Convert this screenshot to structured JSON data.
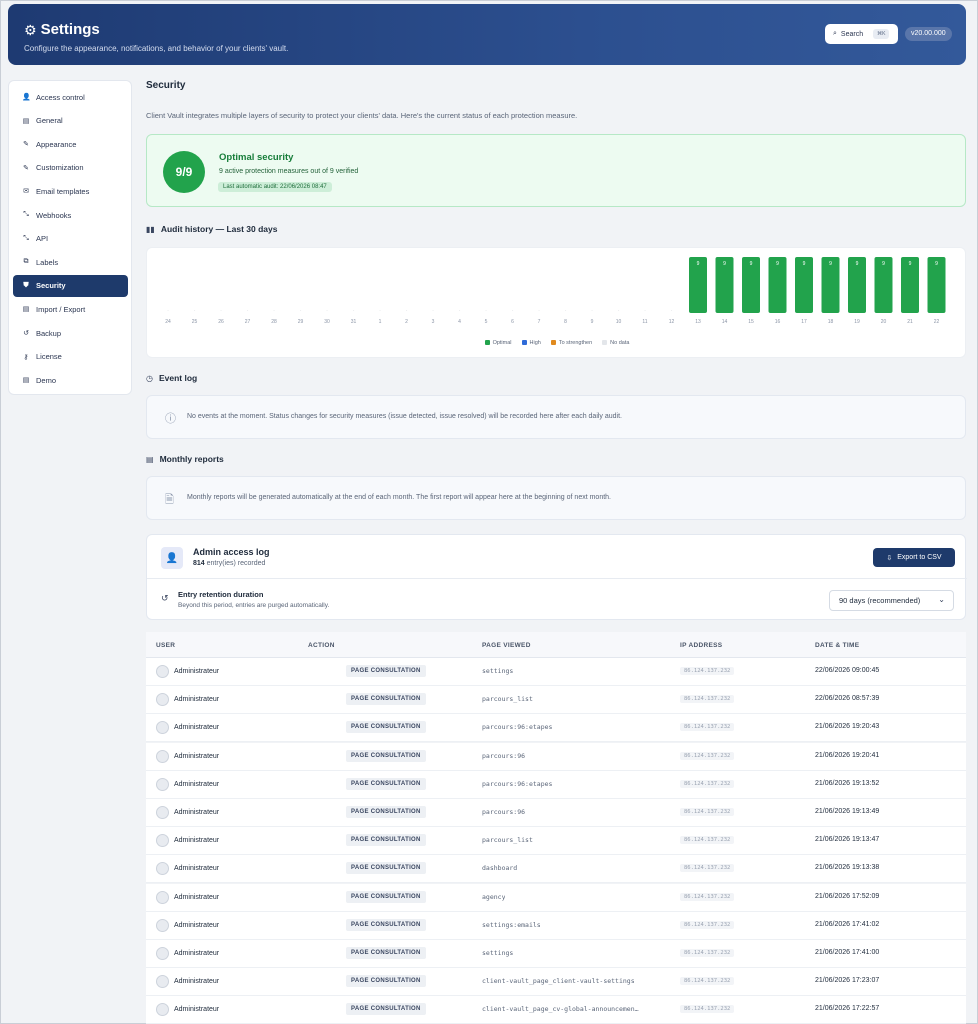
{
  "header": {
    "title": "Settings",
    "subtitle": "Configure the appearance, notifications, and behavior of your clients' vault.",
    "search_label": "Search",
    "search_shortcut": "⌘K",
    "version": "v20.00.000",
    "gear_icon": "gear-icon"
  },
  "sidebar": {
    "items": [
      {
        "label": "Access control",
        "icon": "👤"
      },
      {
        "label": "General",
        "icon": "▤"
      },
      {
        "label": "Appearance",
        "icon": "✎"
      },
      {
        "label": "Customization",
        "icon": "✎"
      },
      {
        "label": "Email templates",
        "icon": "✉"
      },
      {
        "label": "Webhooks",
        "icon": "⤡"
      },
      {
        "label": "API",
        "icon": "⤡"
      },
      {
        "label": "Labels",
        "icon": "⧉"
      },
      {
        "label": "Security",
        "icon": "⛊"
      },
      {
        "label": "Import / Export",
        "icon": "▤"
      },
      {
        "label": "Backup",
        "icon": "↺"
      },
      {
        "label": "License",
        "icon": "⚷"
      },
      {
        "label": "Demo",
        "icon": "▤"
      }
    ],
    "active_index": 8
  },
  "security": {
    "title": "Security",
    "intro": "Client Vault integrates multiple layers of security to protect your clients' data. Here's the current status of each protection measure.",
    "score": "9/9",
    "status_title": "Optimal security",
    "status_sub": "9 active protection measures out of 9 verified",
    "last_audit": "Last automatic audit: 22/06/2026 08:47"
  },
  "audit": {
    "title": "Audit history — Last 30 days",
    "nodata_label": "-"
  },
  "chart_data": {
    "type": "bar",
    "categories": [
      "24",
      "25",
      "26",
      "27",
      "28",
      "29",
      "30",
      "31",
      "1",
      "2",
      "3",
      "4",
      "5",
      "6",
      "7",
      "8",
      "9",
      "10",
      "11",
      "12",
      "13",
      "14",
      "15",
      "16",
      "17",
      "18",
      "19",
      "20",
      "21",
      "22"
    ],
    "values": [
      null,
      null,
      null,
      null,
      null,
      null,
      null,
      null,
      null,
      null,
      null,
      null,
      null,
      null,
      null,
      null,
      null,
      null,
      null,
      null,
      9,
      9,
      9,
      9,
      9,
      9,
      9,
      9,
      9,
      9
    ],
    "status": [
      "No data",
      "No data",
      "No data",
      "No data",
      "No data",
      "No data",
      "No data",
      "No data",
      "No data",
      "No data",
      "No data",
      "No data",
      "No data",
      "No data",
      "No data",
      "No data",
      "No data",
      "No data",
      "No data",
      "No data",
      "Optimal",
      "Optimal",
      "Optimal",
      "Optimal",
      "Optimal",
      "Optimal",
      "Optimal",
      "Optimal",
      "Optimal",
      "Optimal"
    ],
    "ylim": [
      0,
      9
    ],
    "legend": [
      {
        "name": "Optimal",
        "color": "#22a34c"
      },
      {
        "name": "High",
        "color": "#2f6bd8"
      },
      {
        "name": "To strengthen",
        "color": "#e08a1e"
      },
      {
        "name": "No data",
        "color": "#e3e6ea"
      }
    ],
    "legend_position": "bottom-center"
  },
  "event_log": {
    "title": "Event log",
    "message": "No events at the moment. Status changes for security measures (issue detected, issue resolved) will be recorded here after each daily audit."
  },
  "monthly_reports": {
    "title": "Monthly reports",
    "message": "Monthly reports will be generated automatically at the end of each month. The first report will appear here at the beginning of next month."
  },
  "admin_log": {
    "title": "Admin access log",
    "count": "814",
    "count_suffix": "entry(ies) recorded",
    "export_label": "Export to CSV",
    "retention_title": "Entry retention duration",
    "retention_sub": "Beyond this period, entries are purged automatically.",
    "retention_value": "90 days (recommended)"
  },
  "table": {
    "headers": {
      "user": "USER",
      "action": "ACTION",
      "page": "PAGE VIEWED",
      "ip": "IP ADDRESS",
      "date": "DATE & TIME"
    },
    "rows": [
      {
        "user": "Administrateur",
        "action": "PAGE CONSULTATION",
        "page": "settings",
        "ip": "86.124.137.232",
        "date": "22/06/2026 09:00:45"
      },
      {
        "user": "Administrateur",
        "action": "PAGE CONSULTATION",
        "page": "parcours_list",
        "ip": "86.124.137.232",
        "date": "22/06/2026 08:57:39"
      },
      {
        "user": "Administrateur",
        "action": "PAGE CONSULTATION",
        "page": "parcours:96:etapes",
        "ip": "86.124.137.232",
        "date": "21/06/2026 19:20:43"
      },
      {
        "user": "Administrateur",
        "action": "PAGE CONSULTATION",
        "page": "parcours:96",
        "ip": "86.124.137.232",
        "date": "21/06/2026 19:20:41"
      },
      {
        "user": "Administrateur",
        "action": "PAGE CONSULTATION",
        "page": "parcours:96:etapes",
        "ip": "86.124.137.232",
        "date": "21/06/2026 19:13:52"
      },
      {
        "user": "Administrateur",
        "action": "PAGE CONSULTATION",
        "page": "parcours:96",
        "ip": "86.124.137.232",
        "date": "21/06/2026 19:13:49"
      },
      {
        "user": "Administrateur",
        "action": "PAGE CONSULTATION",
        "page": "parcours_list",
        "ip": "86.124.137.232",
        "date": "21/06/2026 19:13:47"
      },
      {
        "user": "Administrateur",
        "action": "PAGE CONSULTATION",
        "page": "dashboard",
        "ip": "86.124.137.232",
        "date": "21/06/2026 19:13:38"
      },
      {
        "user": "Administrateur",
        "action": "PAGE CONSULTATION",
        "page": "agency",
        "ip": "86.124.137.232",
        "date": "21/06/2026 17:52:09"
      },
      {
        "user": "Administrateur",
        "action": "PAGE CONSULTATION",
        "page": "settings:emails",
        "ip": "86.124.137.232",
        "date": "21/06/2026 17:41:02"
      },
      {
        "user": "Administrateur",
        "action": "PAGE CONSULTATION",
        "page": "settings",
        "ip": "86.124.137.232",
        "date": "21/06/2026 17:41:00"
      },
      {
        "user": "Administrateur",
        "action": "PAGE CONSULTATION",
        "page": "client-vault_page_client-vault-settings",
        "ip": "86.124.137.232",
        "date": "21/06/2026 17:23:07"
      },
      {
        "user": "Administrateur",
        "action": "PAGE CONSULTATION",
        "page": "client-vault_page_cv-global-announcemen…",
        "ip": "86.124.137.232",
        "date": "21/06/2026 17:22:57"
      }
    ]
  }
}
